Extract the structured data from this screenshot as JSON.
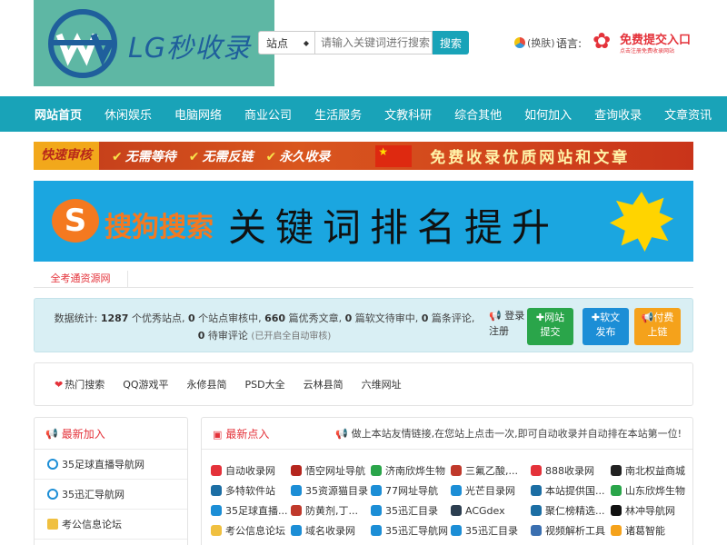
{
  "header": {
    "logo_text": "LG秒收录",
    "search": {
      "select_value": "站点",
      "placeholder": "请输入关键词进行搜索",
      "button": "搜索"
    },
    "skin": "(换肤)",
    "language": "语言:",
    "submit_logo": {
      "title": "免费提交入口",
      "subtitle": "点击注册免费收录网站"
    }
  },
  "nav": [
    "网站首页",
    "休闲娱乐",
    "电脑网络",
    "商业公司",
    "生活服务",
    "文教科研",
    "综合其他",
    "如何加入",
    "查询收录",
    "文章资讯"
  ],
  "banner1": {
    "tag": "快速审核",
    "items": [
      "无需等待",
      "无需反链",
      "永久收录"
    ],
    "slogan": "免费收录优质网站和文章"
  },
  "banner2": {
    "brand": "搜狗搜索",
    "title": "关键词排名提升"
  },
  "tab": "全考通资源网",
  "stats": {
    "prefix": "数据统计:",
    "sites": "1287",
    "sites_label": "个优秀站点,",
    "pending_sites": "0",
    "pending_sites_label": "个站点审核中,",
    "articles": "660",
    "articles_label": "篇优秀文章,",
    "pending_articles": "0",
    "pending_articles_label": "篇软文待审中,",
    "comments": "0",
    "comments_label": "篇条评论,",
    "pending_comments": "0",
    "pending_comments_label": "待审评论",
    "auto_note": "(已开启全自动审核)",
    "login": "登录",
    "register": "注册",
    "btn_site": [
      "网站",
      "提交"
    ],
    "btn_article": [
      "软文",
      "发布"
    ],
    "btn_paid": [
      "付费",
      "上链"
    ]
  },
  "hot": {
    "label": "热门搜索",
    "items": [
      "QQ游戏平",
      "永修县简",
      "PSD大全",
      "云林县简",
      "六维网址"
    ]
  },
  "latest_join": {
    "title": "最新加入",
    "items": [
      "35足球直播导航网",
      "35迅汇导航网",
      "考公信息论坛"
    ]
  },
  "latest_click": {
    "title": "最新点入",
    "note": "做上本站友情链接,在您站上点击一次,即可自动收录并自动排在本站第一位!",
    "items": [
      {
        "name": "自动收录网",
        "color": "#e4323a"
      },
      {
        "name": "悟空网址导航",
        "color": "#b5261e"
      },
      {
        "name": "济南欣烨生物",
        "color": "#2aa54a"
      },
      {
        "name": "三氟乙酸,...",
        "color": "#c0392b"
      },
      {
        "name": "888收录网",
        "color": "#e4323a"
      },
      {
        "name": "南北权益商城",
        "color": "#222222"
      },
      {
        "name": "多特软件站",
        "color": "#1c6ea4"
      },
      {
        "name": "35资源猫目录",
        "color": "#1c8ed6"
      },
      {
        "name": "77网址导航",
        "color": "#1c8ed6"
      },
      {
        "name": "光芒目录网",
        "color": "#1c8ed6"
      },
      {
        "name": "本站提供国...",
        "color": "#1c6ea4"
      },
      {
        "name": "山东欣烨生物",
        "color": "#2aa54a"
      },
      {
        "name": "35足球直播...",
        "color": "#1c8ed6"
      },
      {
        "name": "防黄剂,丁...",
        "color": "#c0392b"
      },
      {
        "name": "35迅汇目录",
        "color": "#1c8ed6"
      },
      {
        "name": "ACGdex",
        "color": "#2c3e50"
      },
      {
        "name": "聚仁榜精选...",
        "color": "#1c6ea4"
      },
      {
        "name": "林冲导航网",
        "color": "#111111"
      },
      {
        "name": "考公信息论坛",
        "color": "#f0c040"
      },
      {
        "name": "域名收录网",
        "color": "#1c8ed6"
      },
      {
        "name": "35迅汇导航网",
        "color": "#1c8ed6"
      },
      {
        "name": "35迅汇目录",
        "color": "#1c8ed6"
      },
      {
        "name": "视频解析工具",
        "color": "#3a6fb0"
      },
      {
        "name": "诸葛智能",
        "color": "#f5a21b"
      }
    ]
  }
}
